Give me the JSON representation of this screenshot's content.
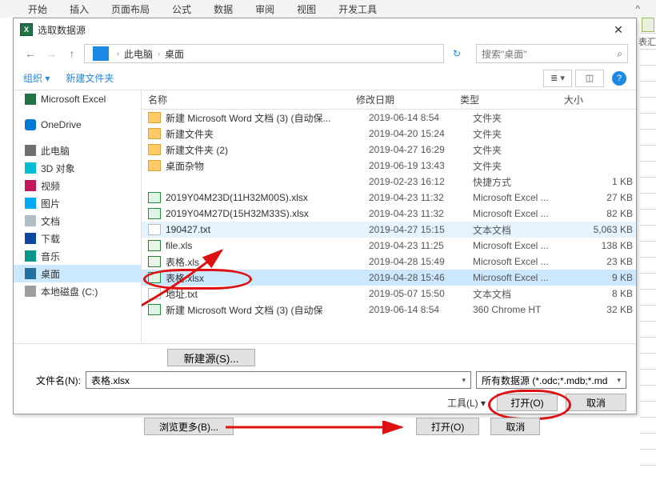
{
  "ribbon": {
    "tabs": [
      "开始",
      "插入",
      "页面布局",
      "公式",
      "数据",
      "审阅",
      "视图",
      "开发工具"
    ]
  },
  "right_label": "表汇",
  "dialog": {
    "title": "选取数据源",
    "breadcrumbs": {
      "root": "此电脑",
      "leaf": "桌面"
    },
    "search_placeholder": "搜索\"桌面\"",
    "organize": "组织 ▾",
    "new_folder": "新建文件夹",
    "columns": {
      "name": "名称",
      "date": "修改日期",
      "type": "类型",
      "size": "大小"
    },
    "files": [
      {
        "icon": "folder",
        "name": "新建 Microsoft Word 文档 (3) (自动保...",
        "date": "2019-06-14 8:54",
        "type": "文件夹",
        "size": ""
      },
      {
        "icon": "folder",
        "name": "新建文件夹",
        "date": "2019-04-20 15:24",
        "type": "文件夹",
        "size": ""
      },
      {
        "icon": "folder",
        "name": "新建文件夹 (2)",
        "date": "2019-04-27 16:29",
        "type": "文件夹",
        "size": ""
      },
      {
        "icon": "folder",
        "name": "桌面杂物",
        "date": "2019-06-19 13:43",
        "type": "文件夹",
        "size": ""
      },
      {
        "icon": "none",
        "name": "",
        "date": "2019-02-23 16:12",
        "type": "快捷方式",
        "size": "1 KB"
      },
      {
        "icon": "xlsx",
        "name": "2019Y04M23D(11H32M00S).xlsx",
        "date": "2019-04-23 11:32",
        "type": "Microsoft Excel ...",
        "size": "27 KB"
      },
      {
        "icon": "xlsx",
        "name": "2019Y04M27D(15H32M33S).xlsx",
        "date": "2019-04-23 11:32",
        "type": "Microsoft Excel ...",
        "size": "82 KB"
      },
      {
        "icon": "txt",
        "name": "190427.txt",
        "date": "2019-04-27 15:15",
        "type": "文本文档",
        "size": "5,063 KB",
        "light": true
      },
      {
        "icon": "xls",
        "name": "file.xls",
        "date": "2019-04-23 11:25",
        "type": "Microsoft Excel ...",
        "size": "138 KB"
      },
      {
        "icon": "xls",
        "name": "表格.xls",
        "date": "2019-04-28 15:49",
        "type": "Microsoft Excel ...",
        "size": "23 KB"
      },
      {
        "icon": "xlsx",
        "name": "表格.xlsx",
        "date": "2019-04-28 15:46",
        "type": "Microsoft Excel ...",
        "size": "9 KB",
        "selected": true,
        "ring": true
      },
      {
        "icon": "txt",
        "name": "地址.txt",
        "date": "2019-05-07 15:50",
        "type": "文本文档",
        "size": "8 KB"
      },
      {
        "icon": "xlsx",
        "name": "新建 Microsoft Word 文档 (3) (自动保",
        "date": "2019-06-14 8:54",
        "type": "360 Chrome HT",
        "size": "32 KB"
      }
    ],
    "sidebar": [
      {
        "ico": "ico-excel",
        "label": "Microsoft Excel"
      },
      {
        "sep": true
      },
      {
        "ico": "ico-cloud",
        "label": "OneDrive"
      },
      {
        "sep": true
      },
      {
        "ico": "ico-pc",
        "label": "此电脑"
      },
      {
        "ico": "ico-3d",
        "label": "3D 对象"
      },
      {
        "ico": "ico-video",
        "label": "视频"
      },
      {
        "ico": "ico-pics",
        "label": "图片"
      },
      {
        "ico": "ico-docs",
        "label": "文档"
      },
      {
        "ico": "ico-dl",
        "label": "下载"
      },
      {
        "ico": "ico-music",
        "label": "音乐"
      },
      {
        "ico": "ico-desktop",
        "label": "桌面",
        "sel": true
      },
      {
        "ico": "ico-disk",
        "label": "本地磁盘 (C:)"
      }
    ],
    "new_source": "新建源(S)...",
    "filename_label": "文件名(N):",
    "filename_value": "表格.xlsx",
    "filetype": "所有数据源 (*.odc;*.mdb;*.md",
    "tools": "工具(L)",
    "open": "打开(O)",
    "cancel": "取消"
  },
  "outer": {
    "browse": "浏览更多(B)...",
    "open": "打开(O)",
    "cancel": "取消"
  }
}
